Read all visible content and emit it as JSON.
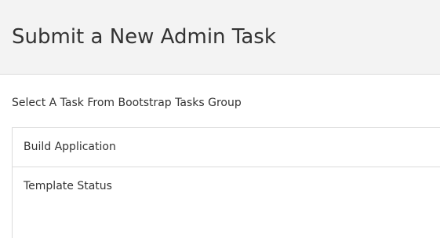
{
  "header": {
    "title": "Submit a New Admin Task"
  },
  "task_group": {
    "label": "Select A Task From Bootstrap Tasks Group",
    "items": [
      {
        "label": "Build Application"
      },
      {
        "label": "Template Status"
      }
    ]
  }
}
